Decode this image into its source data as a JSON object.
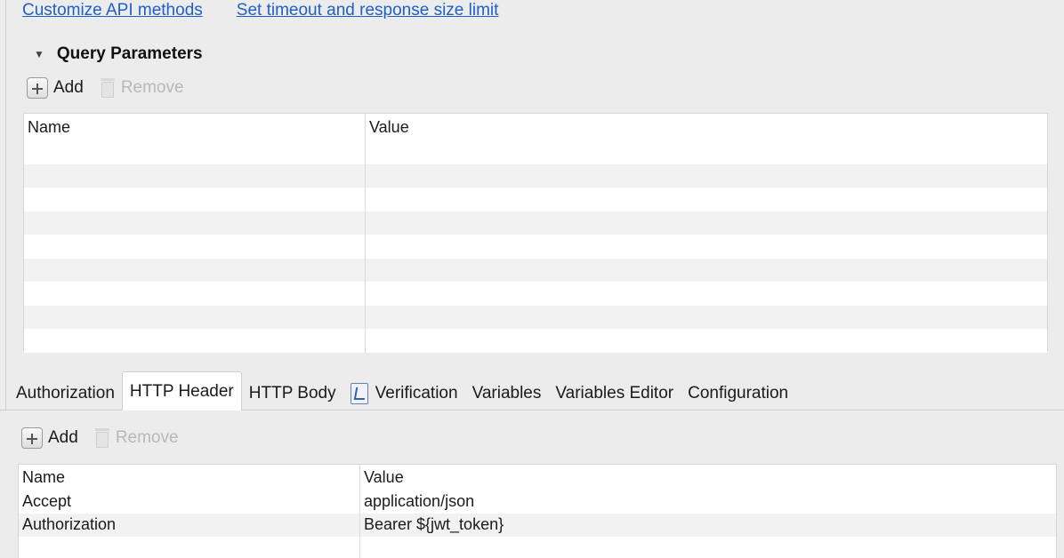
{
  "links": {
    "customize": "Customize API methods",
    "timeout": "Set timeout and response size limit"
  },
  "query_section": {
    "title": "Query Parameters",
    "add_label": "Add",
    "remove_label": "Remove",
    "columns": {
      "name": "Name",
      "value": "Value"
    },
    "rows": []
  },
  "tabs": [
    {
      "label": "Authorization",
      "active": false
    },
    {
      "label": "HTTP Header",
      "active": true
    },
    {
      "label": "HTTP Body",
      "active": false
    },
    {
      "label": "Verification",
      "active": false,
      "icon": "verification-icon"
    },
    {
      "label": "Variables",
      "active": false
    },
    {
      "label": "Variables Editor",
      "active": false
    },
    {
      "label": "Configuration",
      "active": false
    }
  ],
  "header_section": {
    "add_label": "Add",
    "remove_label": "Remove",
    "columns": {
      "name": "Name",
      "value": "Value"
    },
    "rows": [
      {
        "name": "Accept",
        "value": "application/json"
      },
      {
        "name": "Authorization",
        "value": "Bearer ${jwt_token}"
      }
    ]
  },
  "colors": {
    "link": "#1f5fc9",
    "background": "#ececec",
    "row_alt": "#f2f2f2"
  }
}
